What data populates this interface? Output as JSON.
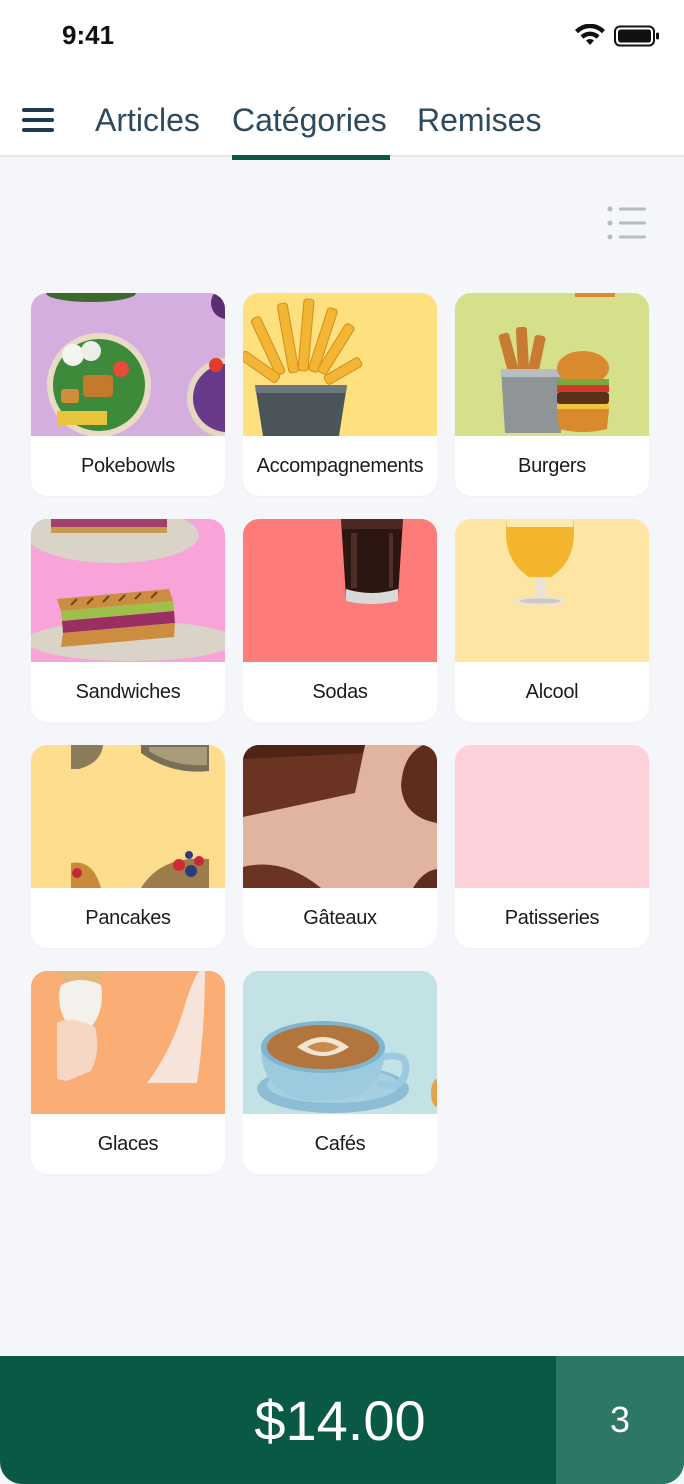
{
  "status_bar": {
    "time": "9:41",
    "icons": [
      "wifi-icon",
      "battery-icon"
    ]
  },
  "nav": {
    "menu_icon": "hamburger-menu-icon",
    "tabs": [
      {
        "label": "Articles",
        "active": false
      },
      {
        "label": "Catégories",
        "active": true
      },
      {
        "label": "Remises",
        "active": false
      }
    ],
    "view_toggle_icon": "list-view-icon"
  },
  "categories": [
    {
      "label": "Pokebowls",
      "bg": "#d5aee0"
    },
    {
      "label": "Accompagnements",
      "bg": "#ffe07e"
    },
    {
      "label": "Burgers",
      "bg": "#d6e08a"
    },
    {
      "label": "Sandwiches",
      "bg": "#f9a3d8"
    },
    {
      "label": "Sodas",
      "bg": "#fd7b79"
    },
    {
      "label": "Alcool",
      "bg": "#ffe5a4"
    },
    {
      "label": "Pancakes",
      "bg": "#fedd8f"
    },
    {
      "label": "Gâteaux",
      "bg": "#e1b49f"
    },
    {
      "label": "Patisseries",
      "bg": "#fed0d9"
    },
    {
      "label": "Glaces",
      "bg": "#faad75"
    },
    {
      "label": "Cafés",
      "bg": "#c3e2e6"
    }
  ],
  "checkout": {
    "total": "$14.00",
    "item_count": "3"
  },
  "colors": {
    "brand": "#0a5846",
    "brand_light": "#2d7766",
    "background": "#f4f6fa",
    "nav_text": "#2e4a5e"
  }
}
